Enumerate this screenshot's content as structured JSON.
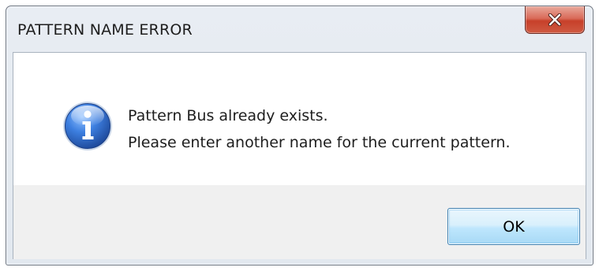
{
  "window": {
    "title": "PATTERN NAME ERROR"
  },
  "message": {
    "icon": "info-icon",
    "line1": "Pattern Bus already exists.",
    "line2": "Please enter another name for the current pattern."
  },
  "buttons": {
    "ok_label": "OK"
  },
  "colors": {
    "close_button": "#c7402a",
    "ok_button_border": "#3c7fb1",
    "footer_background": "#f0f0f0",
    "icon_blue": "#2a5fb8"
  }
}
